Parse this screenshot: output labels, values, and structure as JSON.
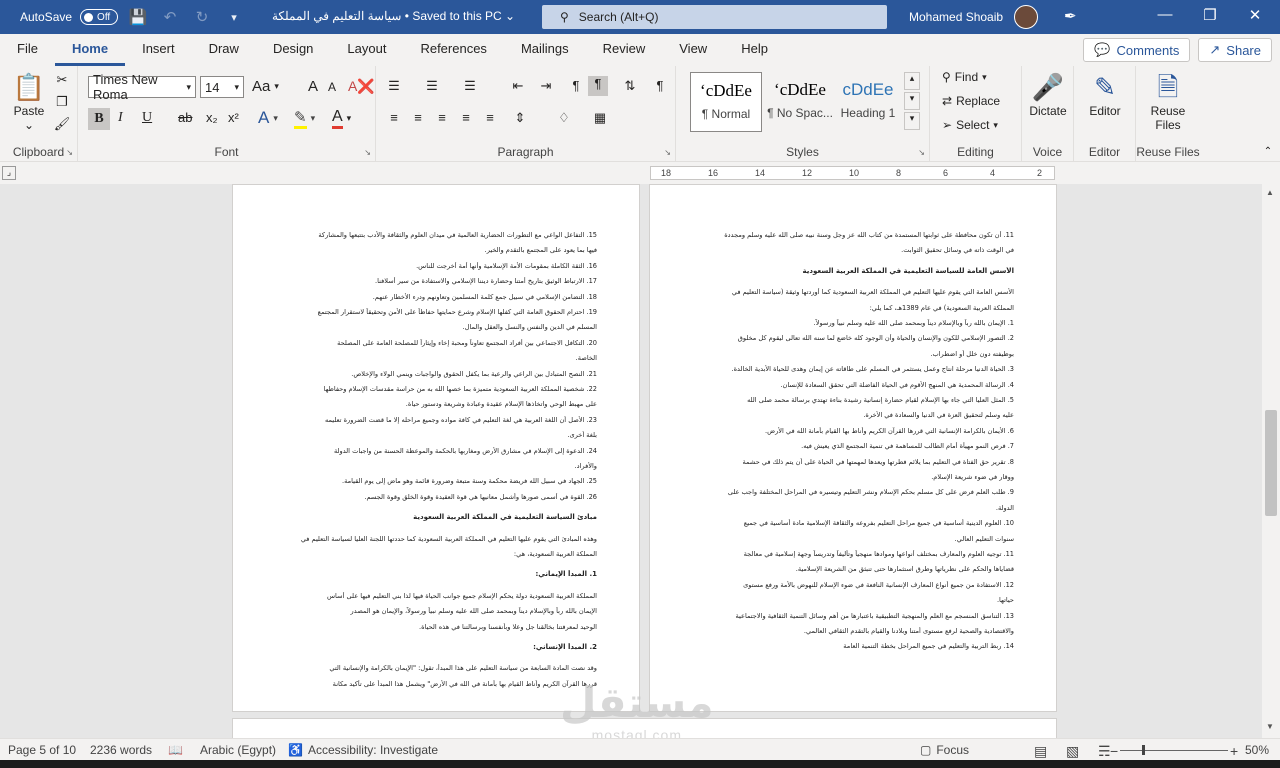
{
  "titlebar": {
    "autosave_label": "AutoSave",
    "autosave_state": "Off",
    "doc_title": "سياسة التعليم في المملكة • Saved to this PC",
    "search_placeholder": "Search (Alt+Q)",
    "user_name": "Mohamed Shoaib"
  },
  "tabs": [
    "File",
    "Home",
    "Insert",
    "Draw",
    "Design",
    "Layout",
    "References",
    "Mailings",
    "Review",
    "View",
    "Help"
  ],
  "active_tab": "Home",
  "comments_label": "Comments",
  "share_label": "Share",
  "ribbon": {
    "clipboard": {
      "label": "Clipboard",
      "paste": "Paste"
    },
    "font": {
      "label": "Font",
      "font_name": "Times New Roma",
      "font_size": "14",
      "bold": "B",
      "italic": "I",
      "underline": "U",
      "strike": "ab",
      "sub": "x₂",
      "sup": "x²",
      "aa": "Aa",
      "grow": "A",
      "shrink": "A"
    },
    "paragraph": {
      "label": "Paragraph"
    },
    "styles": {
      "label": "Styles",
      "items": [
        {
          "preview": "ʻcDdEe",
          "name": "¶ Normal"
        },
        {
          "preview": "ʻcDdEe",
          "name": "¶ No Spac..."
        },
        {
          "preview": "cDdEe",
          "name": "Heading 1"
        }
      ]
    },
    "editing": {
      "label": "Editing",
      "find": "Find",
      "replace": "Replace",
      "select": "Select"
    },
    "voice": {
      "label": "Voice",
      "dictate": "Dictate"
    },
    "editor": {
      "label": "Editor",
      "editor": "Editor"
    },
    "reuse": {
      "label": "Reuse Files",
      "btn1": "Reuse",
      "btn2": "Files"
    }
  },
  "ruler_marks": [
    "18",
    "16",
    "14",
    "12",
    "10",
    "8",
    "6",
    "4",
    "2"
  ],
  "left_page": [
    {
      "text": "15. التفاعل الواعي مع التطورات الحضارية العالمية في ميدان العلوم والثقافة والأدب بتتبعها والمشاركة",
      "h": false
    },
    {
      "text": "فيها بما يعود على المجتمع بالتقدم والخير.",
      "h": false
    },
    {
      "text": "16. الثقة الكاملة بمقومات الأمة الإسلامية وأنها أمة أخرجت للناس.",
      "h": false
    },
    {
      "text": "17. الارتباط الوثيق بتاريخ أمتنا وحضارة ديننا الإسلامي والاستفادة من سير أسلافنا.",
      "h": false
    },
    {
      "text": "18. التضامن الإسلامي في سبيل جمع كلمة المسلمين وتعاونهم ودرء الأخطار عنهم.",
      "h": false
    },
    {
      "text": "19. احترام الحقوق العامة التي كفلها الإسلام وشرع حمايتها حفاظاً على الأمن وتحقيقاً لاستقرار المجتمع",
      "h": false
    },
    {
      "text": "المسلم في الدين والنفس والنسل والعقل والمال.",
      "h": false
    },
    {
      "text": "20. التكافل الاجتماعي بين أفراد المجتمع تعاوناً ومحبة إخاء وإيثاراً للمصلحة العامة على المصلحة",
      "h": false
    },
    {
      "text": "الخاصة.",
      "h": false
    },
    {
      "text": "21. النصح المتبادل بين الراعي والرعية بما يكفل الحقوق والواجبات وينمي الولاء والإخلاص.",
      "h": false
    },
    {
      "text": "22. شخصية المملكة العربية السعودية متميزة بما خصها الله به من حراسة مقدسات الإسلام وحفاظها",
      "h": false
    },
    {
      "text": "على مهبط الوحي واتخاذها الإسلام عقيدة وعبادة وشريعة ودستور حياة.",
      "h": false
    },
    {
      "text": "23. الأصل أن اللغة العربية هي لغة التعليم في كافة مواده وجميع مراحله إلا ما قضت الضرورة تعليمه",
      "h": false
    },
    {
      "text": "بلغة أخرى.",
      "h": false
    },
    {
      "text": "24. الدعوة إلى الإسلام في مشارق الأرض ومغاربها بالحكمة والموعظة الحسنة من واجبات الدولة",
      "h": false
    },
    {
      "text": "والأفراد.",
      "h": false
    },
    {
      "text": "25. الجهاد في سبيل الله فريضة محكمة وسنة متبعة وضرورة قائمة وهو ماض إلى يوم القيامة.",
      "h": false
    },
    {
      "text": "26. القوة في أسمى صورها وأشمل معانيها هي قوة العقيدة وقوة الخلق وقوة الجسم.",
      "h": false
    },
    {
      "text": "مبادئ السياسة التعليمية في المملكة العربية السعودية",
      "h": true
    },
    {
      "text": "وهذه المبادئ التي يقوم عليها التعليم في المملكة العربية السعودية كما حددتها اللجنة العليا لسياسة التعليم في",
      "h": false
    },
    {
      "text": "المملكة العربية السعودية، هي:",
      "h": false
    },
    {
      "text": "1. المبدأ الإيماني:",
      "h": true
    },
    {
      "text": "المملكة العربية السعودية دولة يحكم الإسلام جميع جوانب الحياة فيها لذا بني التعليم فيها على أساس",
      "h": false
    },
    {
      "text": "الإيمان بالله رباً وبالإسلام ديناً وبمحمد صلى الله عليه وسلم نبياً ورسولاً، والإيمان هو المصدر",
      "h": false
    },
    {
      "text": "الوحيد لمعرفتنا بخالقنا جل وعلا وبأنفسنا وبرسالتنا في هذه الحياة.",
      "h": false
    },
    {
      "text": "2. المبدأ الإنساني:",
      "h": true
    },
    {
      "text": "وقد نصت المادة السابعة من سياسة التعليم على هذا المبدأ، تقول: \"الإيمان بالكرامة والإنسانية التي",
      "h": false
    },
    {
      "text": "قررها القرآن الكريم وأناط القيام بها بأمانة في الله في الأرض\" ويشمل هذا المبدأ على تأكيد مكانة",
      "h": false
    }
  ],
  "right_page": [
    {
      "text": "11. أن تكون محافظة على ثوابتها المستمدة من كتاب الله عز وجل وسنة نبيه صلى الله عليه وسلم ومجددة",
      "h": false
    },
    {
      "text": "في الوقت ذاته في وسائل تحقيق الثوابت.",
      "h": false
    },
    {
      "text": "الأسس العامة للسياسة التعليمية في المملكة العربية السعودية",
      "h": true
    },
    {
      "text": "الأسس العامة التي يقوم عليها التعليم في المملكة العربية السعودية كما أوردتها وثيقة (سياسة التعليم في",
      "h": false
    },
    {
      "text": "المملكة العربية السعودية) في عام 1389هـ، كما يلي:",
      "h": false
    },
    {
      "text": "1. الإيمان بالله رباً وبالإسلام ديناً وبمحمد صلى الله عليه وسلم نبياً ورسولاً.",
      "h": false
    },
    {
      "text": "2. التصور الإسلامي للكون والإنسان والحياة وأن الوجود كله خاضع لما سنه الله تعالى ليقوم كل مخلوق",
      "h": false
    },
    {
      "text": "بوظيفته دون خلل أو اضطراب.",
      "h": false
    },
    {
      "text": "3. الحياة الدنيا مرحلة انتاج وعمل يستثمر في المسلم على طاقاته عن إيمان وهدى للحياة الأبدية الخالدة.",
      "h": false
    },
    {
      "text": "4. الرسالة المحمدية هي المنهج الأقوم في الحياة الفاضلة التي تحقق السعادة للإنسان.",
      "h": false
    },
    {
      "text": "5. المثل العليا التي جاء بها الإسلام لقيام حضارة إنسانية رشيدة بناءة تهتدي برسالة محمد صلى الله",
      "h": false
    },
    {
      "text": "عليه وسلم لتحقيق العزة في الدنيا والسعادة في الأخرة.",
      "h": false
    },
    {
      "text": "6. الأيمان بالكرامة الإنسانية التي قررها القرآن الكريم وأناط بها القيام بأمانة الله في الأرض.",
      "h": false
    },
    {
      "text": "7. فرص النمو مهيأة أمام الطالب للمساهمة في تنمية المجتمع الذي يعيش فيه.",
      "h": false
    },
    {
      "text": "8. تقرير حق الفتاة في التعليم بما يلائم فطرتها ويعدها لمهمتها في الحياة على أن يتم ذلك في حشمة",
      "h": false
    },
    {
      "text": "ووقار في ضوء شريعة الإسلام.",
      "h": false
    },
    {
      "text": "9. طلب العلم فرض على كل مسلم بحكم الإسلام ونشر التعليم وتيسيره في المراحل المختلفة واجب على",
      "h": false
    },
    {
      "text": "الدولة.",
      "h": false
    },
    {
      "text": "10. العلوم الدينية أساسية في جميع مراحل التعليم بفروعه والثقافة الإسلامية مادة أساسية في جميع",
      "h": false
    },
    {
      "text": "سنوات التعليم العالي.",
      "h": false
    },
    {
      "text": "11. توجيه العلوم والمعارف بمختلف أنواعها وموادها منهجياً وتأليفاً وتدريساً وجهة إسلامية في معالجة",
      "h": false
    },
    {
      "text": "قضاياها والحكم على نظرياتها وطرق استثمارها حتى تنبثق من الشريعة الإسلامية.",
      "h": false
    },
    {
      "text": "12. الاستفادة من جميع أنواع المعارف الإنسانية النافعة في ضوء الإسلام للنهوض بالأمة ورفع مستوى",
      "h": false
    },
    {
      "text": "حياتها.",
      "h": false
    },
    {
      "text": "13. التناسق المنسجم مع العلم والمنهجية التطبيقية باعتبارها من أهم وسائل التنمية الثقافية والاجتماعية",
      "h": false
    },
    {
      "text": "والاقتصادية والصحية لرفع مستوى أمتنا وبلادنا والقيام بالتقدم الثقافي العالمي.",
      "h": false
    },
    {
      "text": "14. ربط التربية والتعليم في جميع المراحل بخطة التنمية العامة",
      "h": false
    }
  ],
  "status": {
    "page": "Page 5 of 10",
    "words": "2236 words",
    "language": "Arabic (Egypt)",
    "accessibility": "Accessibility: Investigate",
    "focus": "Focus",
    "zoom": "50%"
  },
  "watermark": {
    "arabic": "مستقل",
    "latin": "mostaql.com"
  },
  "colors": {
    "titlebar": "#2b579a",
    "accent": "#2b579a"
  }
}
